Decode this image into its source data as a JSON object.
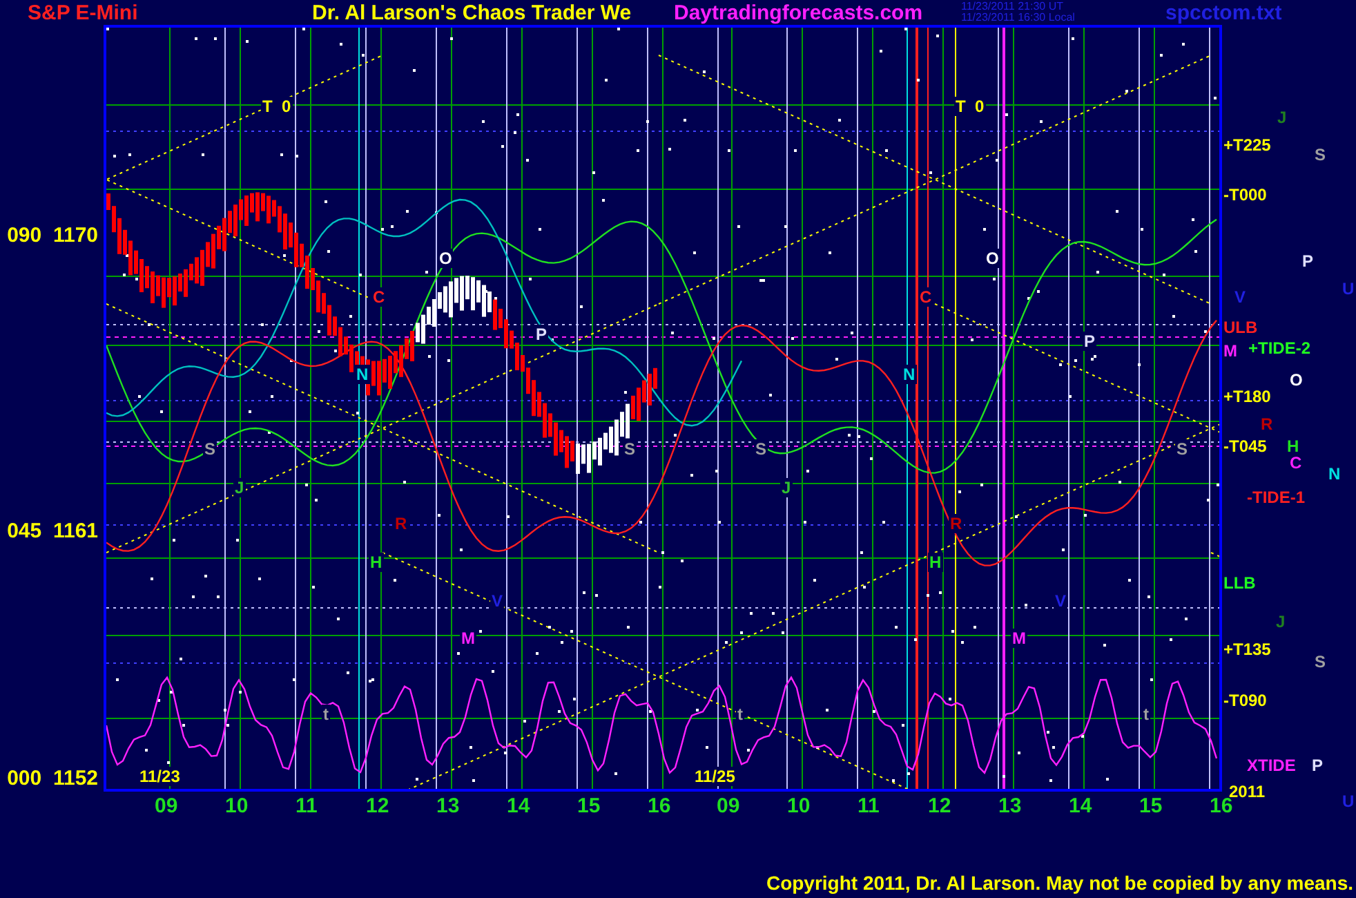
{
  "header": {
    "symbol": "S&P E-Mini",
    "title": "Dr. Al Larson's Chaos Trader We",
    "site": "Daytradingforecasts.com",
    "timestamps": [
      "11/23/2011 21:30 UT",
      "11/23/2011 16:30 Local"
    ],
    "file": "spcctom.txt"
  },
  "y_axis_labels": [
    "090  1170",
    "045  1161",
    "000  1152"
  ],
  "chart_letters": [
    {
      "text": "T  0",
      "color": "#ffff00"
    },
    {
      "text": "T  0",
      "color": "#ffff00"
    },
    {
      "text": "O",
      "color": "#ffffff"
    },
    {
      "text": "O",
      "color": "#ffffff"
    },
    {
      "text": "C",
      "color": "#ff2020"
    },
    {
      "text": "C",
      "color": "#ff2020"
    },
    {
      "text": "N",
      "color": "#00e0e0"
    },
    {
      "text": "N",
      "color": "#00e0e0"
    },
    {
      "text": "P",
      "color": "#e0e0ff"
    },
    {
      "text": "P",
      "color": "#e0e0ff"
    },
    {
      "text": "S",
      "color": "#a0a0a0"
    },
    {
      "text": "S",
      "color": "#a0a0a0"
    },
    {
      "text": "S",
      "color": "#a0a0a0"
    },
    {
      "text": "S",
      "color": "#a0a0a0"
    },
    {
      "text": "R",
      "color": "#c00000"
    },
    {
      "text": "R",
      "color": "#c00000"
    },
    {
      "text": "H",
      "color": "#20e020"
    },
    {
      "text": "H",
      "color": "#20e020"
    },
    {
      "text": "V",
      "color": "#2020e0"
    },
    {
      "text": "V",
      "color": "#2020e0"
    },
    {
      "text": "M",
      "color": "#ff20ff"
    },
    {
      "text": "M",
      "color": "#ff20ff"
    },
    {
      "text": "t",
      "color": "#a0a0a0"
    },
    {
      "text": "t",
      "color": "#a0a0a0"
    },
    {
      "text": "t",
      "color": "#a0a0a0"
    },
    {
      "text": "J",
      "color": "#30c030"
    },
    {
      "text": "J",
      "color": "#30c030"
    },
    {
      "text": "11/23",
      "color": "#ffff00"
    },
    {
      "text": "11/25",
      "color": "#ffff00"
    }
  ],
  "right_labels": [
    {
      "text": "J",
      "color": "#208020"
    },
    {
      "text": "+T225",
      "color": "#ffff00"
    },
    {
      "text": "S",
      "color": "#a0a0a0"
    },
    {
      "text": "-T000",
      "color": "#ffff00"
    },
    {
      "text": "P",
      "color": "#e0e0ff"
    },
    {
      "text": "U",
      "color": "#2020e0"
    },
    {
      "text": "V",
      "color": "#2020e0"
    },
    {
      "text": "ULB",
      "color": "#ff2020"
    },
    {
      "text": "+TIDE-2",
      "color": "#20ff20"
    },
    {
      "text": "M",
      "color": "#ff20ff"
    },
    {
      "text": "O",
      "color": "#ffffff"
    },
    {
      "text": "+T180",
      "color": "#ffff00"
    },
    {
      "text": "R",
      "color": "#c00000"
    },
    {
      "text": "-T045",
      "color": "#ffff00"
    },
    {
      "text": "H",
      "color": "#20e020"
    },
    {
      "text": "C",
      "color": "#ff20ff"
    },
    {
      "text": "N",
      "color": "#00e0e0"
    },
    {
      "text": "-TIDE-1",
      "color": "#ff2020"
    },
    {
      "text": "LLB",
      "color": "#20ff20"
    },
    {
      "text": "J",
      "color": "#208020"
    },
    {
      "text": "+T135",
      "color": "#ffff00"
    },
    {
      "text": "S",
      "color": "#a0a0a0"
    },
    {
      "text": "-T090",
      "color": "#ffff00"
    },
    {
      "text": "XTIDE",
      "color": "#ff20ff"
    },
    {
      "text": "P",
      "color": "#e0e0ff"
    },
    {
      "text": "2011",
      "color": "#ffff00"
    },
    {
      "text": "U",
      "color": "#2020e0"
    }
  ],
  "x_axis_labels": [
    "09",
    "10",
    "11",
    "12",
    "13",
    "14",
    "15",
    "16",
    "09",
    "10",
    "11",
    "12",
    "13",
    "14",
    "15",
    "16"
  ],
  "copyright": "Copyright 2011, Dr. Al Larson. May not be copied by any means."
}
